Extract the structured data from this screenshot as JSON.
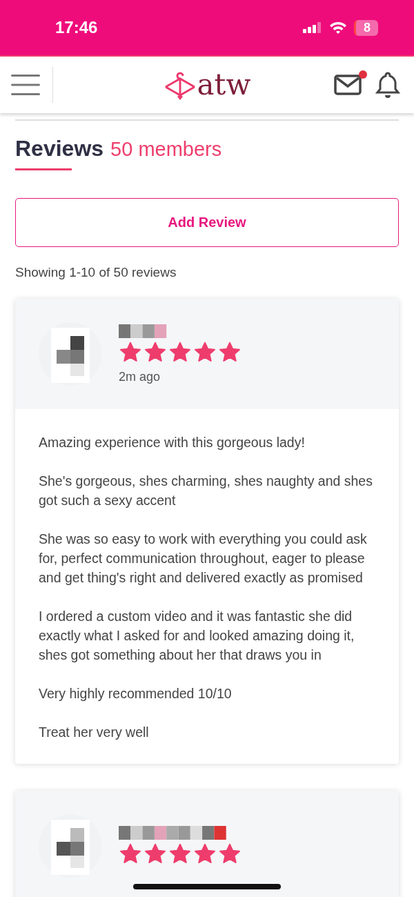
{
  "status_bar": {
    "time": "17:46",
    "battery": "8"
  },
  "header": {
    "logo": "atw",
    "mail_unread": true
  },
  "page": {
    "title": "Reviews",
    "subtitle": "50 members",
    "add_button": "Add Review",
    "summary": "Showing 1-10 of 50 reviews"
  },
  "reviews": [
    {
      "stars": 5,
      "time": "2m ago",
      "paragraphs": [
        "Amazing experience with this gorgeous lady!",
        "She's gorgeous, shes charming, shes naughty and shes got such a sexy accent",
        "She was so easy to work with everything you could ask for, perfect communication throughout, eager to please and get thing's right and delivered exactly as promised",
        "I ordered a custom video and it was fantastic she did exactly what I asked for and looked amazing doing it, shes got something about her that draws you in",
        "Very highly recommended 10/10",
        "Treat her very well"
      ]
    },
    {
      "stars": 5
    }
  ]
}
